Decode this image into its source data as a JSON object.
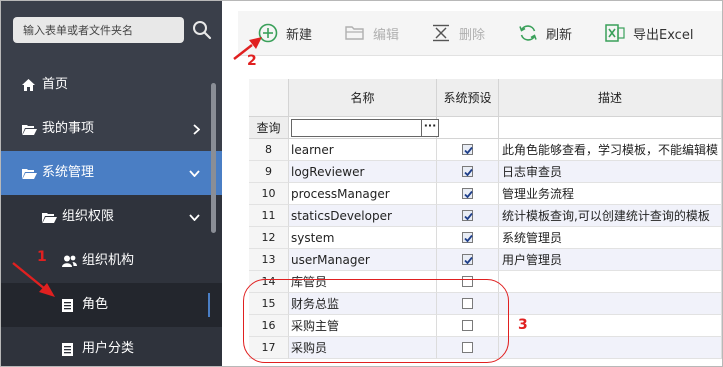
{
  "sidebar": {
    "search_placeholder": "输入表单或者文件夹名",
    "items": [
      {
        "label": "首页",
        "icon": "home-icon"
      },
      {
        "label": "我的事项",
        "icon": "folder-open-icon"
      },
      {
        "label": "系统管理",
        "icon": "folder-open-icon"
      },
      {
        "label": "组织权限",
        "icon": "folder-open-icon"
      },
      {
        "label": "组织机构",
        "icon": "users-icon"
      },
      {
        "label": "角色",
        "icon": "document-icon"
      },
      {
        "label": "用户分类",
        "icon": "document-icon"
      }
    ]
  },
  "toolbar": {
    "new_label": "新建",
    "edit_label": "编辑",
    "delete_label": "删除",
    "refresh_label": "刷新",
    "export_label": "导出Excel"
  },
  "grid": {
    "columns": [
      "名称",
      "系统预设",
      "描述"
    ],
    "query_label": "查询",
    "filter_button": "···",
    "rows": [
      {
        "num": "8",
        "name": "learner",
        "preset": true,
        "desc": "此角色能够查看，学习模板，不能编辑模"
      },
      {
        "num": "9",
        "name": "logReviewer",
        "preset": true,
        "desc": "日志审查员"
      },
      {
        "num": "10",
        "name": "processManager",
        "preset": true,
        "desc": "管理业务流程"
      },
      {
        "num": "11",
        "name": "staticsDeveloper",
        "preset": true,
        "desc": "统计模板查询,可以创建统计查询的模板"
      },
      {
        "num": "12",
        "name": "system",
        "preset": true,
        "desc": "系统管理员"
      },
      {
        "num": "13",
        "name": "userManager",
        "preset": true,
        "desc": "用户管理员"
      },
      {
        "num": "14",
        "name": "库管员",
        "preset": false,
        "desc": ""
      },
      {
        "num": "15",
        "name": "财务总监",
        "preset": false,
        "desc": ""
      },
      {
        "num": "16",
        "name": "采购主管",
        "preset": false,
        "desc": ""
      },
      {
        "num": "17",
        "name": "采购员",
        "preset": false,
        "desc": ""
      }
    ]
  },
  "annotations": {
    "n1": "1",
    "n2": "2",
    "n3": "3",
    "color": "#e02020"
  },
  "colors": {
    "sidebar_bg": "#3a3f4a",
    "active_bg": "#4a7ec4",
    "accent_green": "#3aa05a"
  }
}
